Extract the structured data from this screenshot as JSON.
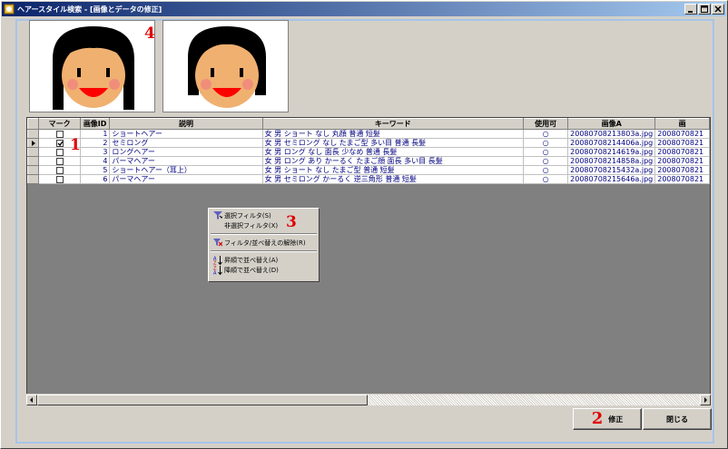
{
  "window": {
    "title": "ヘアースタイル検索 - [画像とデータの修正]"
  },
  "markers": {
    "one": "1",
    "two": "2",
    "three": "3",
    "four": "4"
  },
  "grid": {
    "columns": [
      "マーク",
      "画像ID",
      "説明",
      "キーワード",
      "使用可",
      "画像A",
      "画"
    ],
    "rows": [
      {
        "checked": false,
        "id": "1",
        "desc": "ショートヘアー",
        "keyword": "女 男 ショート なし 丸顔 普通 短髪",
        "usable": "○",
        "imgA": "20080708213803a.jpg",
        "imgB": "2008070821"
      },
      {
        "checked": true,
        "id": "2",
        "desc": "セミロング",
        "keyword": "女 男 セミロング なし たまご型 多い目 普通 長髪",
        "usable": "○",
        "imgA": "20080708214406a.jpg",
        "imgB": "2008070821"
      },
      {
        "checked": false,
        "id": "3",
        "desc": "ロングヘアー",
        "keyword": "女 男 ロング なし 面長 少なめ 普通 長髪",
        "usable": "○",
        "imgA": "20080708214619a.jpg",
        "imgB": "2008070821"
      },
      {
        "checked": false,
        "id": "4",
        "desc": "パーマヘアー",
        "keyword": "女 男 ロング あり かーるく たまご顔 面長 多い目 長髪",
        "usable": "○",
        "imgA": "20080708214858a.jpg",
        "imgB": "2008070821"
      },
      {
        "checked": false,
        "id": "5",
        "desc": "ショートヘアー（耳上）",
        "keyword": "女 男 ショート なし たまご型 普通 短髪",
        "usable": "○",
        "imgA": "20080708215432a.jpg",
        "imgB": "2008070821"
      },
      {
        "checked": false,
        "id": "6",
        "desc": "パーマヘアー",
        "keyword": "女 男 セミロング かーるく 逆三角形 普通 短髪",
        "usable": "○",
        "imgA": "20080708215646a.jpg",
        "imgB": "2008070821"
      }
    ]
  },
  "context_menu": {
    "filter_select": "選択フィルタ(S)",
    "filter_exclude": "非選択フィルタ(X)",
    "clear_filter": "フィルタ/並べ替えの解除(R)",
    "sort_asc": "昇順で並べ替え(A)",
    "sort_desc": "降順で並べ替え(D)"
  },
  "buttons": {
    "modify": "修正",
    "close": "閉じる"
  },
  "colors": {
    "marker_red": "#e00000",
    "title_bar": "#0a246a",
    "frame_border": "#a7c4e8"
  }
}
